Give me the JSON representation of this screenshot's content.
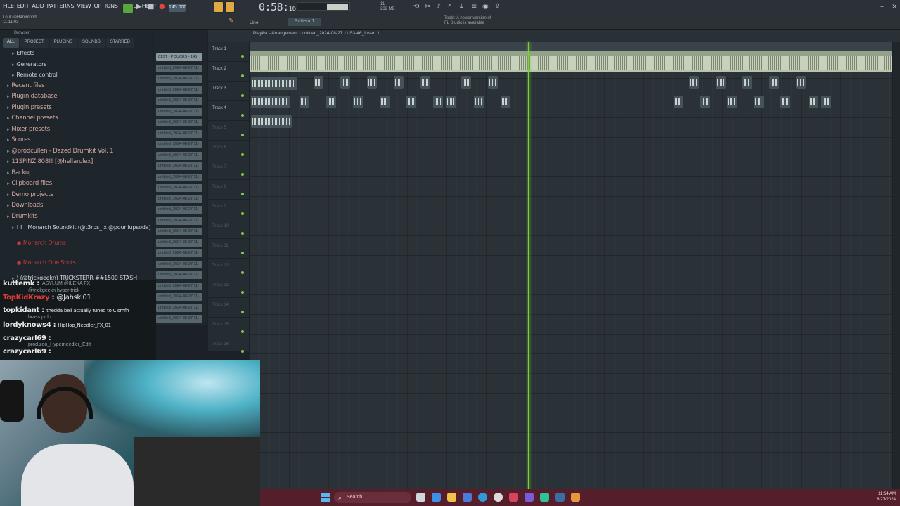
{
  "menu": [
    "FILE",
    "EDIT",
    "ADD",
    "PATTERNS",
    "VIEW",
    "OPTIONS",
    "TOOLS",
    "HELP"
  ],
  "user": {
    "name": "LouLueHammond",
    "time": "11:11:03"
  },
  "toolbar": {
    "tempo": "145.000",
    "song_time": "0:58",
    "song_time_sub": "16",
    "pattern": "Pattern 1",
    "snap": "Line",
    "cpu": "11",
    "mem": "232 MB",
    "news_line1": "Tools: A newer version of",
    "news_line2": "FL Studio is available"
  },
  "browser": {
    "title": "Browser",
    "tabs": [
      "ALL",
      "PROJECT",
      "PLUGINS",
      "SOUNDS",
      "STARRED"
    ],
    "items": [
      {
        "label": "Effects",
        "kind": "sub"
      },
      {
        "label": "Generators",
        "kind": "sub"
      },
      {
        "label": "Remote control",
        "kind": "sub"
      },
      {
        "label": "Recent files",
        "kind": "top"
      },
      {
        "label": "Plugin database",
        "kind": "top"
      },
      {
        "label": "Plugin presets",
        "kind": "top"
      },
      {
        "label": "Channel presets",
        "kind": "top"
      },
      {
        "label": "Mixer presets",
        "kind": "top"
      },
      {
        "label": "Scores",
        "kind": "top"
      },
      {
        "label": "@prodcullen - Dazed Drumkit Vol. 1",
        "kind": "top"
      },
      {
        "label": "11SPINZ 808!! [@hellarolex]",
        "kind": "top"
      },
      {
        "label": "Backup",
        "kind": "top"
      },
      {
        "label": "Clipboard files",
        "kind": "top"
      },
      {
        "label": "Demo projects",
        "kind": "top"
      },
      {
        "label": "Downloads",
        "kind": "top"
      },
      {
        "label": "Drumkits",
        "kind": "top"
      },
      {
        "label": "! ! ! Monarch Soundkit (@t3rps_ x @pourilupsoda)",
        "kind": "sub"
      },
      {
        "label": "Monarch Drums",
        "kind": "red"
      },
      {
        "label": "Monarch One Shots",
        "kind": "red"
      },
      {
        "label": "! (@trickgeekn) TRICKSTERR ##1500 STASH",
        "kind": "sub"
      }
    ]
  },
  "channels": [
    "01ST - POUCES - 145",
    "untitled_2024-08-27 11-",
    "untitled_2024-08-27 11-",
    "untitled_2024-08-27 11-",
    "untitled_2024-08-27 11-",
    "untitled_2024-08-27 11-",
    "untitled_2024-08-27 11-",
    "untitled_2024-08-27 11-",
    "untitled_2024-08-27 11-",
    "untitled_2024-08-27 11-",
    "untitled_2024-08-27 11-",
    "untitled_2024-08-27 11-",
    "untitled_2024-08-27 11-",
    "untitled_2024-08-27 11-",
    "untitled_2024-08-27 11-",
    "untitled_2024-08-27 11-",
    "untitled_2024-08-27 11-",
    "untitled_2024-08-27 11-",
    "untitled_2024-08-27 11-",
    "untitled_2024-08-27 11-",
    "untitled_2024-08-27 11-",
    "untitled_2024-08-27 11-",
    "untitled_2024-08-27 11-",
    "untitled_2024-08-27 11-",
    "untitled_2024-08-27 11-"
  ],
  "playlist": {
    "title": "Playlist - Arrangement",
    "subtitle": "untitled_2024-08-27 11-53-46_Insert 1"
  },
  "tracks": [
    "Track 1",
    "Track 2",
    "Track 3",
    "Track 4",
    "Track 5",
    "Track 6",
    "Track 7",
    "Track 8",
    "Track 9",
    "Track 10",
    "Track 11",
    "Track 12",
    "Track 13",
    "Track 14",
    "Track 15",
    "Track 16"
  ],
  "chat": [
    {
      "user": "kuttemk",
      "text": ""
    },
    {
      "user": "TopKidKrazy",
      "text": "@Jahski01"
    },
    {
      "user": "topkidant",
      "text": "thedda bell actually tuned to C smfh"
    },
    {
      "user": "lordyknows4",
      "text": "HipHop_Needler_FX_01"
    },
    {
      "user": "crazycarl69",
      "text": ""
    },
    {
      "user": "crazycarl69",
      "text": ""
    }
  ],
  "chat_sub": [
    "ASYLUM @ILEKA FX",
    "@trickgeekn hyper trick",
    "brass pr lo",
    "prod.zoo_Hyperneedler_Edit"
  ],
  "taskbar": {
    "search": "Search",
    "time": "11:54 AM",
    "date": "8/27/2024"
  },
  "colors": {
    "playhead": "#7fcf3a",
    "taskbar": "#541e2a",
    "clip": "#b8c4a8"
  }
}
